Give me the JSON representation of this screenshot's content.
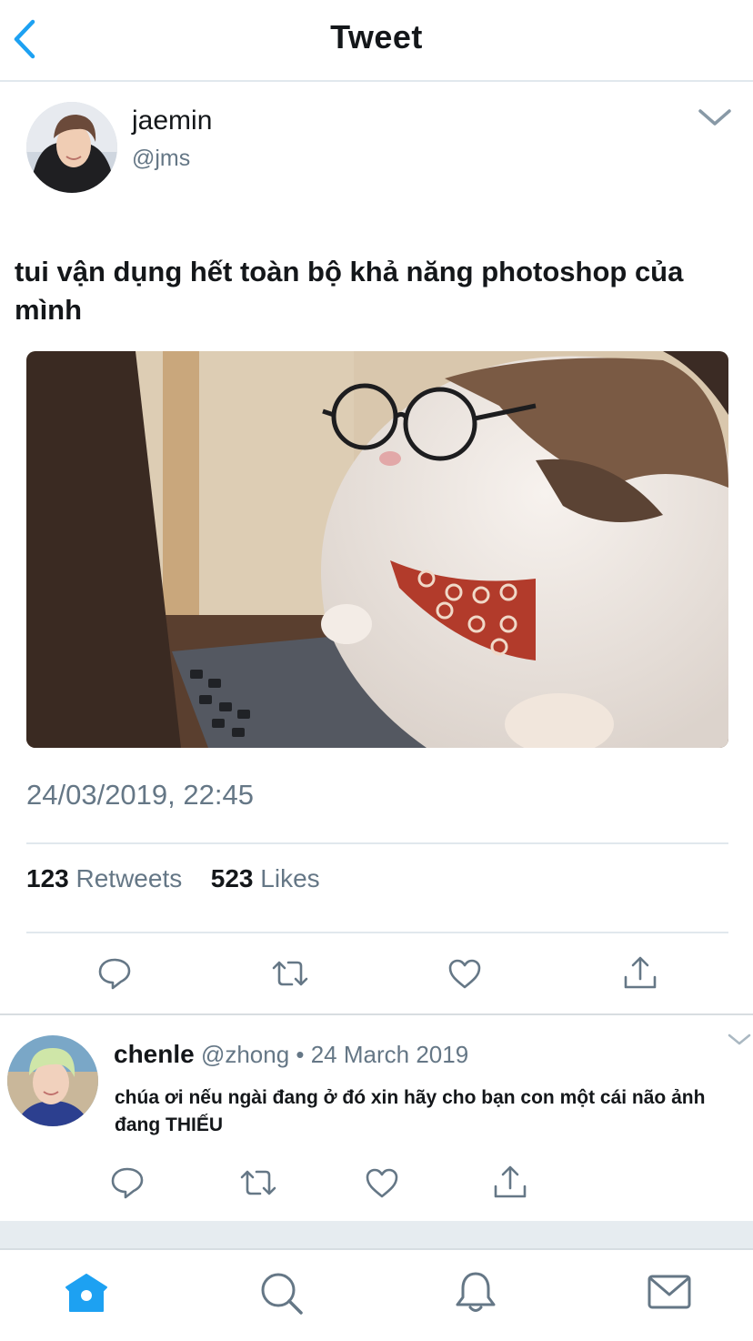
{
  "header": {
    "title": "Tweet"
  },
  "tweet": {
    "author_name": "jaemin",
    "author_handle": "@jms",
    "text": "tui vận dụng hết toàn bộ khả năng photoshop của mình",
    "timestamp": "24/03/2019, 22:45",
    "retweets_count": "123",
    "retweets_label": "Retweets",
    "likes_count": "523",
    "likes_label": "Likes",
    "actions": [
      "reply-icon",
      "retweet-icon",
      "like-icon",
      "share-icon"
    ]
  },
  "reply": {
    "author_name": "chenle",
    "meta": "@zhong • 24 March 2019",
    "text": "chúa ơi nếu ngài đang ở đó xin hãy cho bạn con một cái não ảnh đang THIẾU",
    "actions": [
      "reply-icon",
      "retweet-icon",
      "like-icon",
      "share-icon"
    ]
  },
  "tab_bar": {
    "tabs": [
      "home-icon",
      "search-icon",
      "notifications-icon",
      "messages-icon"
    ],
    "active": "home-icon"
  },
  "colors": {
    "accent": "#1da1f2",
    "text_primary": "#14171a",
    "text_secondary": "#657786",
    "icon_gray": "#657786",
    "divider": "#e1e8ed"
  }
}
